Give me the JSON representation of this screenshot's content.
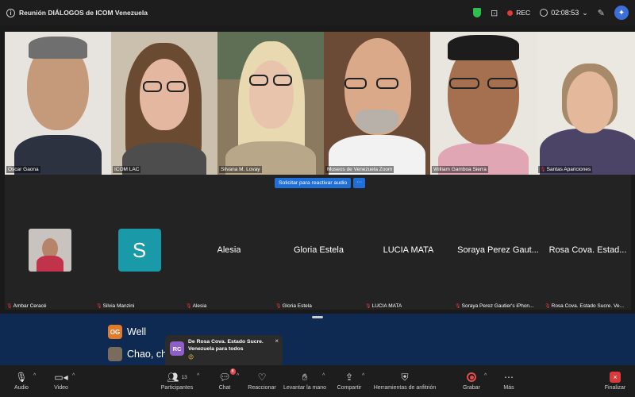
{
  "window": {
    "title": "Reunión DIÁLOGOS de ICOM Venezuela"
  },
  "status": {
    "rec_label": "REC",
    "timer": "02:08:53"
  },
  "video_participants": [
    {
      "name": "Oscar Gaona"
    },
    {
      "name": "ICOM LAC"
    },
    {
      "name": "Silvana M. Lovay"
    },
    {
      "name": "Museos de Venezuela Zoom"
    },
    {
      "name": "William Gamboa Sierra"
    },
    {
      "name": "Santas Apariciones"
    }
  ],
  "audio_banner": {
    "label": "Solicitar para reactivar audio",
    "more": "···"
  },
  "other_participants": [
    {
      "display": "",
      "tag": "Ámbar Ceracé"
    },
    {
      "display": "S",
      "tag": "Silvia Manzini"
    },
    {
      "display": "Alesia",
      "tag": "Alesia"
    },
    {
      "display": "Gloria Estela",
      "tag": "Gloria Estela"
    },
    {
      "display": "LUCIA MATA",
      "tag": "LUCIA MATA"
    },
    {
      "display": "Soraya Perez Gaut...",
      "tag": "Soraya Perez Gautier's iPhon..."
    },
    {
      "display": "Rosa Cova. Estad...",
      "tag": "Rosa Cova. Estado Sucre. Ve..."
    }
  ],
  "chat": {
    "line1_avatar": "OG",
    "line1_text": "Well",
    "line2_text": "Chao, ch",
    "toast_avatar": "RC",
    "toast_text": "De Rosa Cova. Estado Sucre. Venezuela para todos",
    "toast_close": "×"
  },
  "toolbar": {
    "audio": "Audio",
    "video": "Video",
    "participants": "Participantes",
    "participants_count": "13",
    "chat": "Chat",
    "chat_badge": "8",
    "react": "Reaccionar",
    "raise_hand": "Levantar la mano",
    "share": "Compartir",
    "host_tools": "Herramientas de anfitrión",
    "record": "Grabar",
    "more": "Más",
    "end": "Finalizar"
  },
  "colors": {
    "accent": "#1f6fd6",
    "active_speaker": "#2ea84f",
    "rec": "#e53935",
    "chat_bg": "#0f2a52"
  }
}
